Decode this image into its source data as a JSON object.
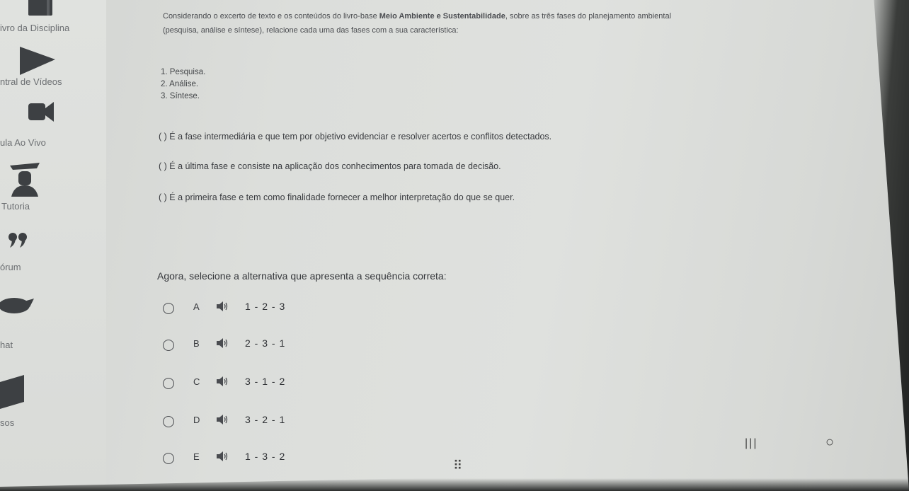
{
  "sidebar": {
    "items": [
      {
        "label": "ivro da Disciplina",
        "icon": "book-icon"
      },
      {
        "label": "ntral de Vídeos",
        "icon": "play-icon"
      },
      {
        "label": "ula Ao Vivo",
        "icon": "video-camera-icon"
      },
      {
        "label": "Tutoria",
        "icon": "graduate-icon"
      },
      {
        "label": "órum",
        "icon": "quote-icon"
      },
      {
        "label": "hat",
        "icon": "chat-bubble-icon"
      },
      {
        "label": "sos",
        "icon": "document-icon"
      }
    ]
  },
  "question": {
    "intro_line1_a": "Considerando o excerto de texto e os conteúdos do livro-base ",
    "intro_line1_b": "Meio Ambiente e Sustentabilidade",
    "intro_line1_c": ", sobre as três fases do planejamento ambiental",
    "intro_line2": "(pesquisa, análise e síntese), relacione cada uma das fases com a sua característica:",
    "steps": [
      "1. Pesquisa.",
      "2. Análise.",
      "3. Síntese."
    ],
    "statements": [
      "(  ) É a fase intermediária e que tem por objetivo evidenciar e resolver acertos e conflitos detectados.",
      "(  ) É a última fase e consiste na aplicação dos conhecimentos para tomada de decisão.",
      "(  ) É a primeira fase e tem como finalidade fornecer a melhor interpretação do que se quer."
    ],
    "prompt": "Agora, selecione a alternativa que apresenta a sequência correta:",
    "options": [
      {
        "letter": "A",
        "text": "1 - 2 - 3"
      },
      {
        "letter": "B",
        "text": "2 - 3 - 1"
      },
      {
        "letter": "C",
        "text": "3 - 1 - 2"
      },
      {
        "letter": "D",
        "text": "3 - 2 - 1"
      },
      {
        "letter": "E",
        "text": "1 - 3 - 2"
      }
    ]
  },
  "system_nav": {
    "recents": "|||",
    "home": "○",
    "grid": "⠿"
  }
}
